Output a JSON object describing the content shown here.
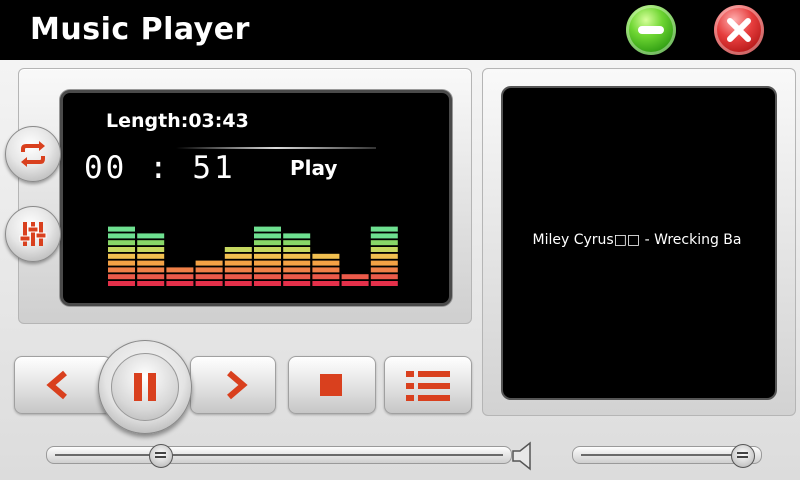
{
  "window": {
    "title": "Music Player"
  },
  "player": {
    "length_label": "Length:03:43",
    "elapsed": "00 : 51",
    "status": "Play",
    "track_title": "Miley Cyrus□□ - Wrecking Ba",
    "progress_fraction": 0.23,
    "volume_fraction": 0.96
  },
  "equalizer": {
    "bar_levels": [
      9,
      8,
      3,
      4,
      6,
      9,
      8,
      5,
      2,
      9
    ],
    "max_level": 10,
    "colors": [
      "#e4304a",
      "#ec5a4a",
      "#f08048",
      "#f5a245",
      "#f2c050",
      "#c6d860",
      "#88d868",
      "#6ee090"
    ]
  },
  "icons": {
    "minimize": "minimize-icon",
    "close": "close-icon",
    "repeat": "repeat-icon",
    "equalizer": "equalizer-sliders-icon",
    "previous": "previous-icon",
    "pause": "pause-icon",
    "next": "next-icon",
    "stop": "stop-icon",
    "playlist": "playlist-icon",
    "volume": "speaker-icon"
  },
  "colors": {
    "accent": "#d9401e",
    "minimize_green": "#4cc021",
    "close_red": "#d82a2a",
    "screen_bg": "#000000"
  }
}
